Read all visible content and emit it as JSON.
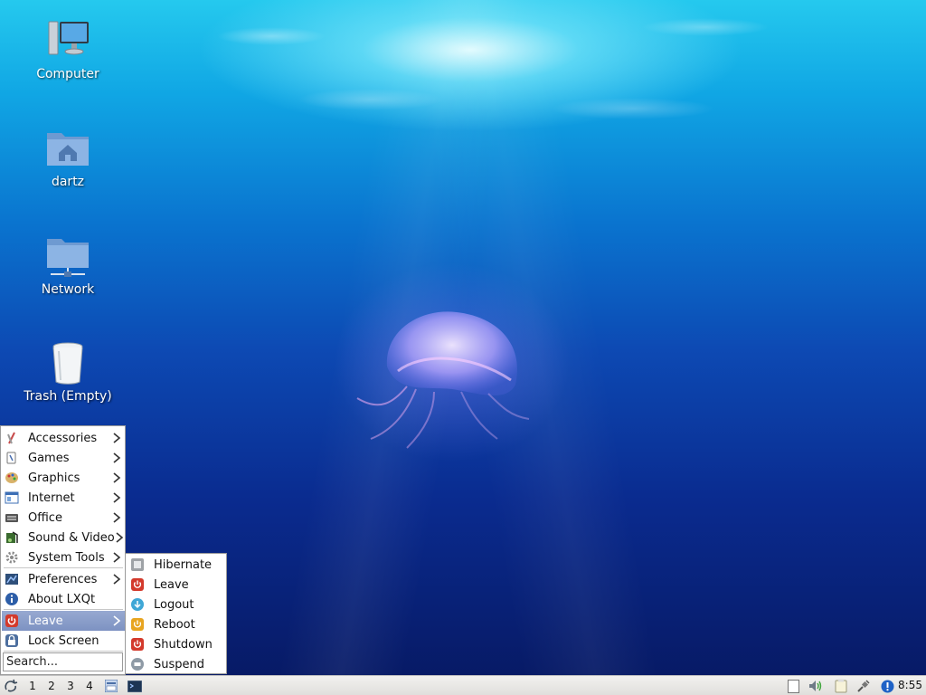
{
  "desktop": {
    "icons": [
      {
        "label": "Computer",
        "icon": "computer-icon"
      },
      {
        "label": "dartz",
        "icon": "home-folder-icon"
      },
      {
        "label": "Network",
        "icon": "network-folder-icon"
      },
      {
        "label": "Trash (Empty)",
        "icon": "trash-icon"
      }
    ]
  },
  "main_menu": {
    "items": [
      {
        "label": "Accessories",
        "icon": "accessories-icon",
        "has_submenu": true
      },
      {
        "label": "Games",
        "icon": "games-icon",
        "has_submenu": true
      },
      {
        "label": "Graphics",
        "icon": "graphics-icon",
        "has_submenu": true
      },
      {
        "label": "Internet",
        "icon": "internet-icon",
        "has_submenu": true
      },
      {
        "label": "Office",
        "icon": "office-icon",
        "has_submenu": true
      },
      {
        "label": "Sound & Video",
        "icon": "sound-video-icon",
        "has_submenu": true
      },
      {
        "label": "System Tools",
        "icon": "system-tools-icon",
        "has_submenu": true
      },
      {
        "label": "Preferences",
        "icon": "preferences-icon",
        "has_submenu": true
      },
      {
        "label": "About LXQt",
        "icon": "info-icon",
        "has_submenu": false
      },
      {
        "label": "Leave",
        "icon": "power-icon",
        "has_submenu": true,
        "active": true
      },
      {
        "label": "Lock Screen",
        "icon": "lock-icon",
        "has_submenu": false
      }
    ],
    "search_placeholder": "Search..."
  },
  "leave_submenu": {
    "items": [
      {
        "label": "Hibernate",
        "icon": "hibernate-icon"
      },
      {
        "label": "Leave",
        "icon": "power-icon"
      },
      {
        "label": "Logout",
        "icon": "logout-icon"
      },
      {
        "label": "Reboot",
        "icon": "reboot-icon"
      },
      {
        "label": "Shutdown",
        "icon": "shutdown-icon"
      },
      {
        "label": "Suspend",
        "icon": "suspend-icon"
      }
    ]
  },
  "taskbar": {
    "desktops": [
      "1",
      "2",
      "3",
      "4"
    ],
    "clock": "8:55"
  },
  "colors": {
    "menu_highlight": "#8a9dc9",
    "water_top": "#25c9ee",
    "water_bottom": "#071a66"
  }
}
